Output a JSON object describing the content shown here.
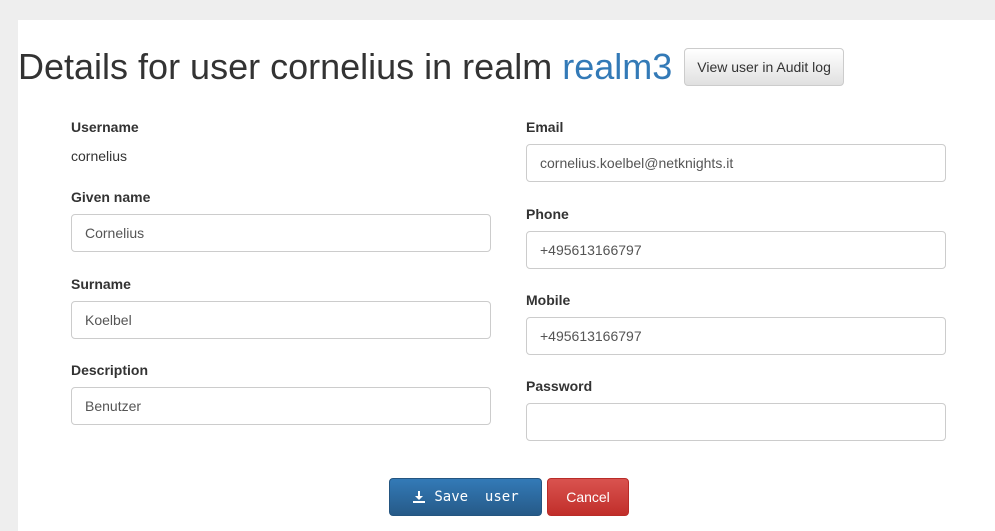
{
  "header": {
    "title_prefix": "Details for user cornelius in realm",
    "realm": "realm3",
    "audit_button_label": "View user in Audit log"
  },
  "fields": {
    "username": {
      "label": "Username",
      "value": "cornelius"
    },
    "given_name": {
      "label": "Given name",
      "value": "Cornelius"
    },
    "surname": {
      "label": "Surname",
      "value": "Koelbel"
    },
    "description": {
      "label": "Description",
      "value": "Benutzer"
    },
    "email": {
      "label": "Email",
      "value": "cornelius.koelbel@netknights.it"
    },
    "phone": {
      "label": "Phone",
      "value": "+495613166797"
    },
    "mobile": {
      "label": "Mobile",
      "value": "+495613166797"
    },
    "password": {
      "label": "Password",
      "value": ""
    }
  },
  "actions": {
    "save_label": "Save  user",
    "cancel_label": "Cancel",
    "save_icon": "download-icon"
  },
  "colors": {
    "link": "#337ab7",
    "primary": "#337ab7",
    "danger": "#d9534f"
  }
}
